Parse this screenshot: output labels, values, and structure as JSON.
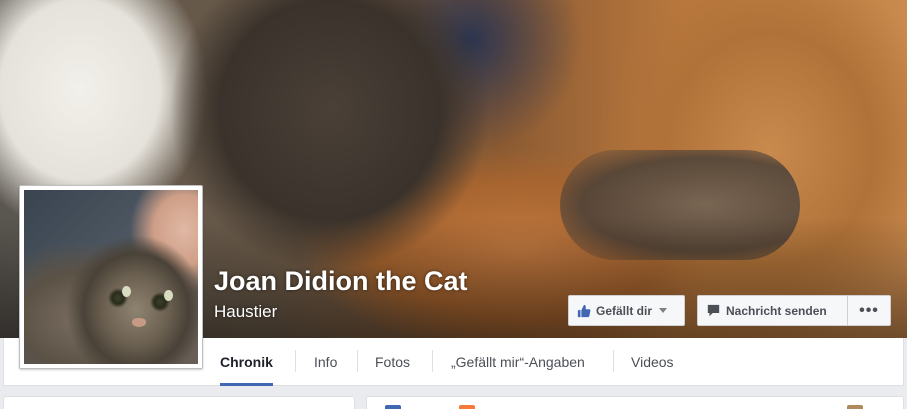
{
  "page": {
    "name": "Joan Didion the Cat",
    "category": "Haustier"
  },
  "actions": {
    "like_label": "Gefällt dir",
    "message_label": "Nachricht senden",
    "more_label": "•••"
  },
  "tabs": [
    {
      "label": "Chronik",
      "active": true
    },
    {
      "label": "Info",
      "active": false
    },
    {
      "label": "Fotos",
      "active": false
    },
    {
      "label": "„Gefällt mir“-Angaben",
      "active": false
    },
    {
      "label": "Videos",
      "active": false
    }
  ],
  "icons": {
    "like": "thumbs-up-icon",
    "message": "speech-bubble-icon",
    "more": "more-dots-icon",
    "caret": "caret-down-icon"
  },
  "colors": {
    "accent": "#4267b2",
    "like_icon": "#4267b2",
    "tab_text": "#4b4f56",
    "page_bg": "#e9ebee"
  }
}
